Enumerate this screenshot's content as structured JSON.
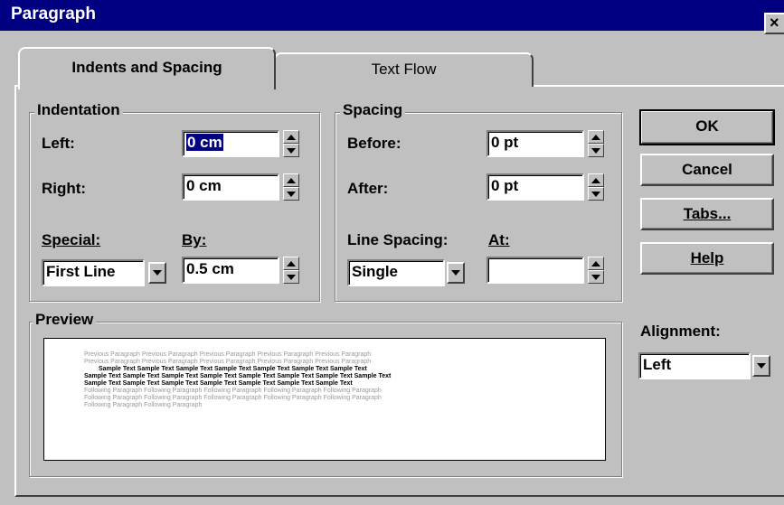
{
  "window": {
    "title": "Paragraph",
    "close_glyph": "×"
  },
  "tabs": [
    {
      "label": "Indents and Spacing",
      "selected": true
    },
    {
      "label": "Text Flow",
      "selected": false
    }
  ],
  "indentation": {
    "title": "Indentation",
    "left_label": "Left:",
    "left_value": "0 cm",
    "right_label": "Right:",
    "right_value": "0 cm",
    "special_label": "Special:",
    "special_value": "First Line",
    "by_label": "By:",
    "by_value": "0.5 cm"
  },
  "spacing": {
    "title": "Spacing",
    "before_label": "Before:",
    "before_value": "0 pt",
    "after_label": "After:",
    "after_value": "0 pt",
    "line_spacing_label": "Line Spacing:",
    "line_spacing_value": "Single",
    "at_label": "At:",
    "at_value": ""
  },
  "buttons": {
    "ok": "OK",
    "cancel": "Cancel",
    "tabs": "Tabs...",
    "help": "Help"
  },
  "alignment": {
    "label": "Alignment:",
    "value": "Left"
  },
  "preview": {
    "title": "Preview",
    "previous_lines": [
      "Previous Paragraph Previous Paragraph Previous Paragraph Previous Paragraph Previous Paragraph",
      "Previous Paragraph Previous Paragraph Previous Paragraph Previous Paragraph Previous Paragraph"
    ],
    "sample_lines": [
      "Sample Text Sample Text Sample Text Sample Text Sample Text Sample Text Sample Text",
      "Sample Text Sample Text Sample Text Sample Text Sample Text Sample Text Sample Text Sample Text",
      "Sample Text Sample Text Sample Text Sample Text Sample Text Sample Text Sample Text"
    ],
    "following_lines": [
      "Following Paragraph Following Paragraph Following Paragraph Following Paragraph Following Paragraph",
      "Following Paragraph Following Paragraph Following Paragraph Following Paragraph Following Paragraph",
      "Following Paragraph Following Paragraph"
    ]
  }
}
